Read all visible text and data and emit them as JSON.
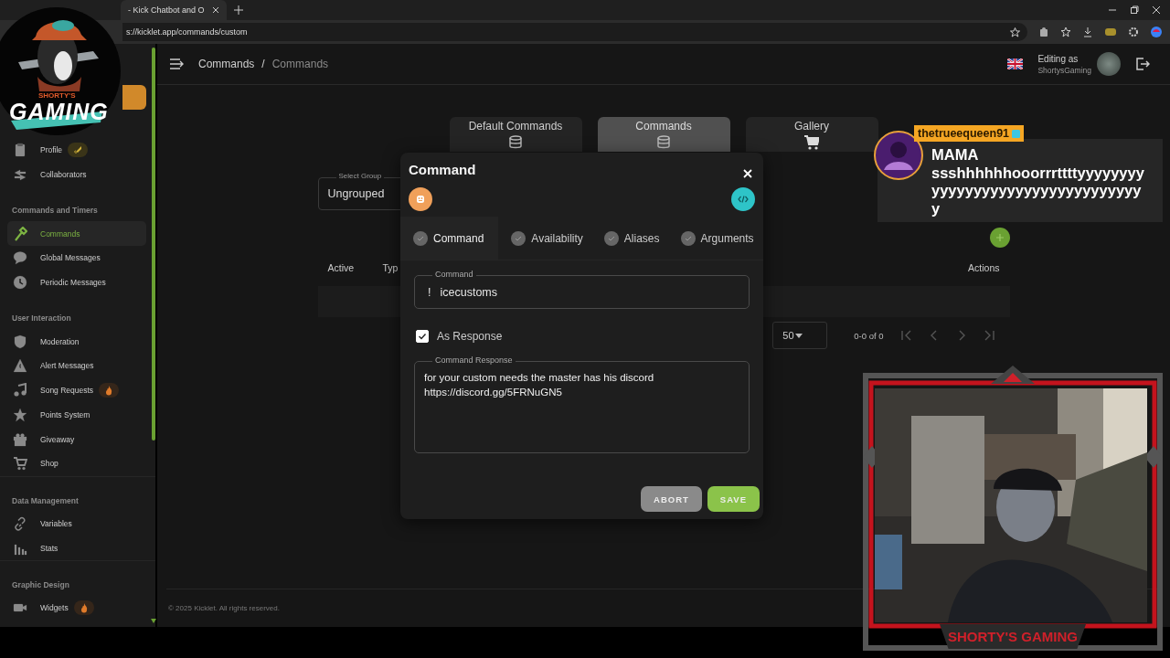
{
  "browser": {
    "tab_title": "- Kick Chatbot and O",
    "address": "s://kicklet.app/commands/custom"
  },
  "logo": {
    "top_text": "SHORTY'S",
    "main_text": "GAMING"
  },
  "header": {
    "breadcrumb": [
      {
        "label": "Commands",
        "current": false
      },
      {
        "label": "Commands",
        "current": true
      }
    ],
    "separator": "/",
    "editing_label": "Editing as",
    "username": "ShortysGaming"
  },
  "sidebar": {
    "sections": [
      {
        "items": [
          {
            "label": "Profile",
            "selected": false,
            "kind": "new"
          },
          {
            "label": "Collaborators",
            "selected": false,
            "kind": "plain"
          }
        ]
      },
      {
        "title": "Commands and Timers",
        "items": [
          {
            "label": "Commands",
            "selected": true,
            "kind": "plain"
          },
          {
            "label": "Global Messages",
            "selected": false,
            "kind": "plain"
          },
          {
            "label": "Periodic Messages",
            "selected": false,
            "kind": "plain"
          }
        ]
      },
      {
        "title": "User Interaction",
        "items": [
          {
            "label": "Moderation",
            "selected": false,
            "kind": "plain"
          },
          {
            "label": "Alert Messages",
            "selected": false,
            "kind": "plain"
          },
          {
            "label": "Song Requests",
            "selected": false,
            "kind": "hot"
          },
          {
            "label": "Points System",
            "selected": false,
            "kind": "plain"
          },
          {
            "label": "Giveaway",
            "selected": false,
            "kind": "plain"
          },
          {
            "label": "Shop",
            "selected": false,
            "kind": "plain"
          }
        ]
      },
      {
        "title": "Data Management",
        "items": [
          {
            "label": "Variables",
            "selected": false,
            "kind": "plain"
          },
          {
            "label": "Stats",
            "selected": false,
            "kind": "plain"
          }
        ]
      },
      {
        "title": "Graphic Design",
        "items": [
          {
            "label": "Widgets",
            "selected": false,
            "kind": "hot"
          }
        ]
      }
    ]
  },
  "tabs": [
    {
      "label": "Default Commands",
      "selected": false
    },
    {
      "label": "Commands",
      "selected": true
    },
    {
      "label": "Gallery",
      "selected": false
    }
  ],
  "select_group": {
    "label": "Select Group",
    "value": "Ungrouped"
  },
  "table": {
    "columns": [
      "Active",
      "Typ",
      "Actions"
    ]
  },
  "pagination": {
    "per_page": "50",
    "range": "0-0 of 0"
  },
  "footer": "© 2025 Kicklet. All rights reserved.",
  "modal": {
    "title": "Command",
    "steps": [
      {
        "label": "Command",
        "selected": true
      },
      {
        "label": "Availability",
        "selected": false
      },
      {
        "label": "Aliases",
        "selected": false
      },
      {
        "label": "Arguments",
        "selected": false
      }
    ],
    "command_field": {
      "label": "Command",
      "prefix": "!",
      "value": "icecustoms"
    },
    "as_response": {
      "label": "As Response",
      "checked": true
    },
    "response_field": {
      "label": "Command Response",
      "value": "for your custom needs the master has his discord https://discord.gg/5FRNuGN5"
    },
    "buttons": [
      {
        "label": "ABORT",
        "kind": "secondary"
      },
      {
        "label": "SAVE",
        "kind": "primary"
      }
    ]
  },
  "chat": {
    "username": "thetrueequeen91",
    "message": "MAMA ssshhhhhhooorrrttttyyyyyyyyyyyyyyyyyyyyyyyyyyyyyyyyyy"
  },
  "webcam": {
    "banner": "SHORTY'S GAMING"
  }
}
